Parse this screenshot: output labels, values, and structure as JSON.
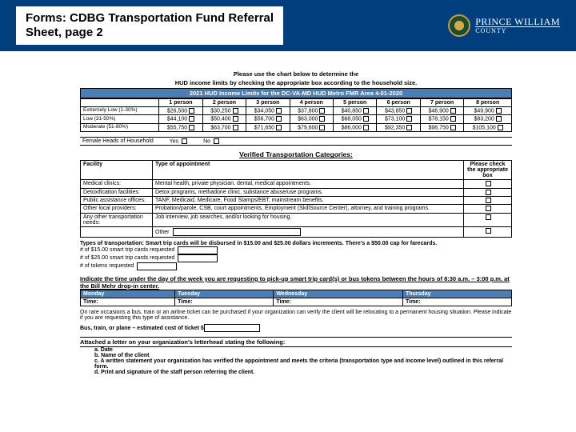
{
  "header": {
    "title_line1": "Forms: CDBG Transportation Fund Referral",
    "title_line2": "Sheet, page 2",
    "county_name": "PRINCE WILLIAM",
    "county_sub": "COUNTY"
  },
  "intro": {
    "line1": "Please use the chart below to determine the",
    "line2": "HUD income limits by checking the appropriate box according to the household size."
  },
  "income": {
    "title": "2021 HUD Income Limits for the DC-VA-MD HUD Metro FMR Area 4-01-2020",
    "headers": [
      "1 person",
      "2 person",
      "3 person",
      "4 person",
      "5 person",
      "6 person",
      "7 person",
      "8 person"
    ],
    "rows": [
      {
        "label": "Extremely Low (1-30%)",
        "vals": [
          "$26,500",
          "$30,250",
          "$34,050",
          "$37,800",
          "$40,850",
          "$43,850",
          "$46,900",
          "$49,900"
        ]
      },
      {
        "label": "Low (31-50%)",
        "vals": [
          "$44,100",
          "$50,400",
          "$56,700",
          "$63,000",
          "$68,050",
          "$73,100",
          "$78,150",
          "$83,200"
        ]
      },
      {
        "label": "Moderate (51-80%)",
        "vals": [
          "$55,750",
          "$63,700",
          "$71,650",
          "$79,600",
          "$86,000",
          "$92,350",
          "$98,750",
          "$105,100"
        ]
      }
    ]
  },
  "female": {
    "label": "Female Heads of Household",
    "yes": "Yes",
    "no": "No"
  },
  "categories": {
    "title": "Verified Transportation Categories:",
    "headers": [
      "Facility",
      "Type of appointment",
      "Please check the appropriate box"
    ],
    "rows": [
      {
        "fac": "Medical clinics:",
        "type": "Mental health, private physician, dental, medical appointments."
      },
      {
        "fac": "Detoxification facilities:",
        "type": "Detox programs, methadone clinic, substance abuse/use programs."
      },
      {
        "fac": "Public assistance offices:",
        "type": "TANF, Medicaid, Medicare, Food Stamps/EBT, mainstream benefits."
      },
      {
        "fac": "Other local providers:",
        "type": "Probation/parole, CSB, court appointments, Employment (SkillSource Center), attorney, and training programs."
      },
      {
        "fac": "Any other transportation needs:",
        "type": "Job interview, job searches, and/or looking for housing."
      }
    ],
    "other_label": "Other"
  },
  "transport": {
    "types_line": "Types of transportation: Smart trip cards will be disbursed in $15.00 and $25.00 dollars increments.  There's a $50.00 cap for farecards.",
    "req1": "# of $15.00 smart trip cards requested",
    "req2": "# of $25.00 smart trip cards requested",
    "req3": "# of tokens requested"
  },
  "schedule": {
    "indicate": "Indicate the time under the day of the week you are requesting to pick-up smart trip card(s) or bus tokens between the hours of 8:30 a.m. – 3:00 p.m. at the Bill Mehr drop-in center.",
    "days": [
      "Monday",
      "Tuesday",
      "Wednesday",
      "Thursday"
    ],
    "time_label": "Time:"
  },
  "rare": {
    "line1": "On rare occasions a bus, train or an airline ticket can be purchased if your organization can verify the client will be relocating to a permanent housing situation.  Please indicate if you are requesting this type of assistance.",
    "line2": "Bus, train, or plane – estimated cost of ticket $"
  },
  "attach": {
    "head": "Attached a letter on your organization's letterhead stating the following:",
    "items": [
      "a.   Date",
      "b.   Name of the client",
      "c.   A written statement your organization has verified the appointment and meets the criteria (transportation type and income level) outlined in this referral form.",
      "d.   Print and signature of the staff person referring the client."
    ]
  }
}
